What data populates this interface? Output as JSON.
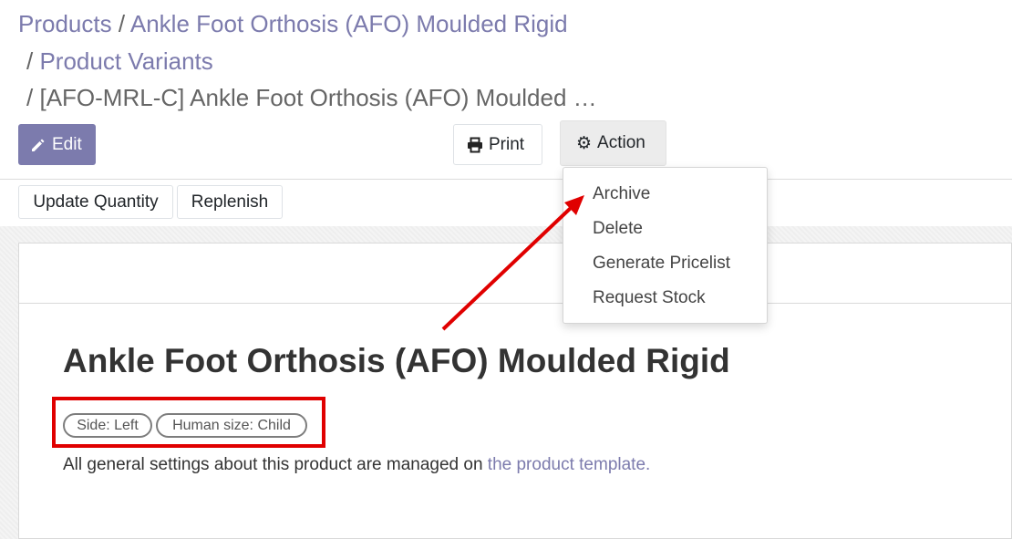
{
  "breadcrumb": {
    "items": [
      {
        "label": "Products"
      },
      {
        "label": "Ankle Foot Orthosis (AFO) Moulded Rigid"
      },
      {
        "label": "Product Variants"
      }
    ],
    "current": "[AFO-MRL-C] Ankle Foot Orthosis (AFO) Moulded …",
    "separator": "/"
  },
  "toolbar": {
    "edit_label": "Edit",
    "print_label": "Print",
    "action_label": "Action"
  },
  "action_menu": {
    "items": [
      "Archive",
      "Delete",
      "Generate Pricelist",
      "Request Stock"
    ]
  },
  "header_buttons": {
    "update_quantity": "Update Quantity",
    "replenish": "Replenish"
  },
  "form": {
    "title": "Ankle Foot Orthosis (AFO) Moulded Rigid",
    "tags": [
      "Side: Left",
      "Human size: Child"
    ],
    "info_text": "All general settings about this product are managed on ",
    "info_link": "the product template."
  },
  "colors": {
    "primary": "#7c7bad",
    "annotation": "#e00000"
  },
  "icons": {
    "edit": "pencil-icon",
    "print": "printer-icon",
    "action": "gear-icon"
  }
}
